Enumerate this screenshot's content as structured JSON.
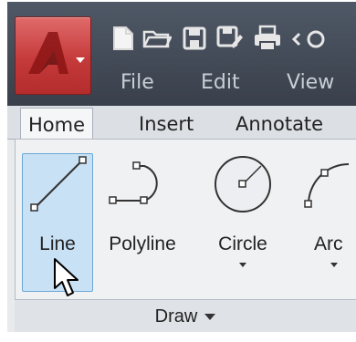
{
  "app": {
    "logo_letter": "A"
  },
  "quick_access": [
    {
      "icon": "new-file-icon"
    },
    {
      "icon": "open-folder-icon"
    },
    {
      "icon": "save-icon"
    },
    {
      "icon": "save-as-icon"
    },
    {
      "icon": "print-icon"
    }
  ],
  "menu": {
    "file": "File",
    "edit": "Edit",
    "view": "View"
  },
  "tabs": {
    "home": "Home",
    "insert": "Insert",
    "annotate": "Annotate"
  },
  "tools": {
    "line": "Line",
    "polyline": "Polyline",
    "circle": "Circle",
    "arc": "Arc"
  },
  "panel": {
    "title": "Draw"
  },
  "colors": {
    "accent": "#c53a3a",
    "title_bar": "#444b56",
    "highlight": "#c8e1f5"
  }
}
